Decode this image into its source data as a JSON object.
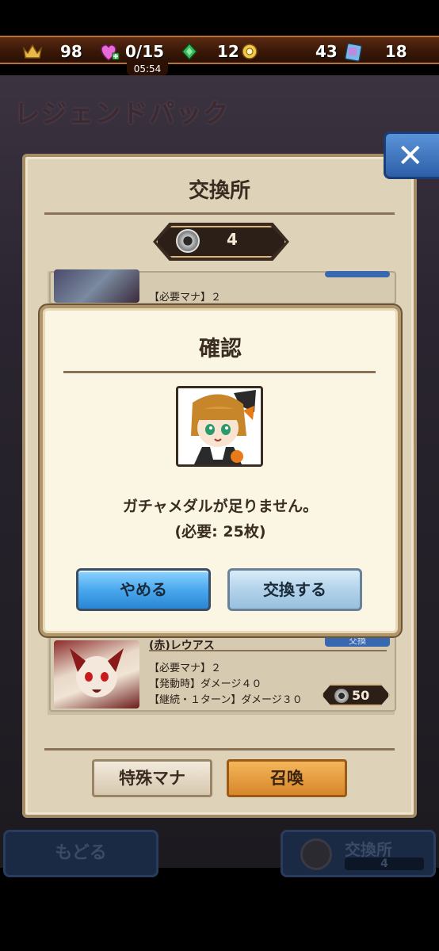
{
  "status_bar": {
    "rank": "98",
    "stamina": "0/15",
    "gems": "12",
    "time": "05:54",
    "tickets": "43",
    "cards": "18"
  },
  "background": {
    "pack_title": "レジェンドパック",
    "back_button": "もどる",
    "exchange_shortcut_label": "交換所",
    "exchange_shortcut_count": "4"
  },
  "exchange_panel": {
    "title": "交換所",
    "medal_count": "4",
    "items": [
      {
        "partial_line": "【必要マナ】２"
      },
      {
        "name": "(赤)レウアス",
        "badge": "交換",
        "lines": [
          "【必要マナ】２",
          "【発動時】ダメージ４０",
          "【継続・１ターン】ダメージ３０"
        ],
        "cost": "50"
      }
    ],
    "special_mana_button": "特殊マナ",
    "summon_button": "召喚"
  },
  "dialog": {
    "title": "確認",
    "message": "ガチャメダルが足りません。",
    "requirement": "(必要: 25枚)",
    "cancel_label": "やめる",
    "exchange_label": "交換する"
  },
  "colors": {
    "panel_bg": "#ded2b8",
    "dialog_bg": "#fbf6e4",
    "cancel_button": "#4aa8ee",
    "exchange_button": "#b2d2ea",
    "summon_button": "#d8862a"
  }
}
